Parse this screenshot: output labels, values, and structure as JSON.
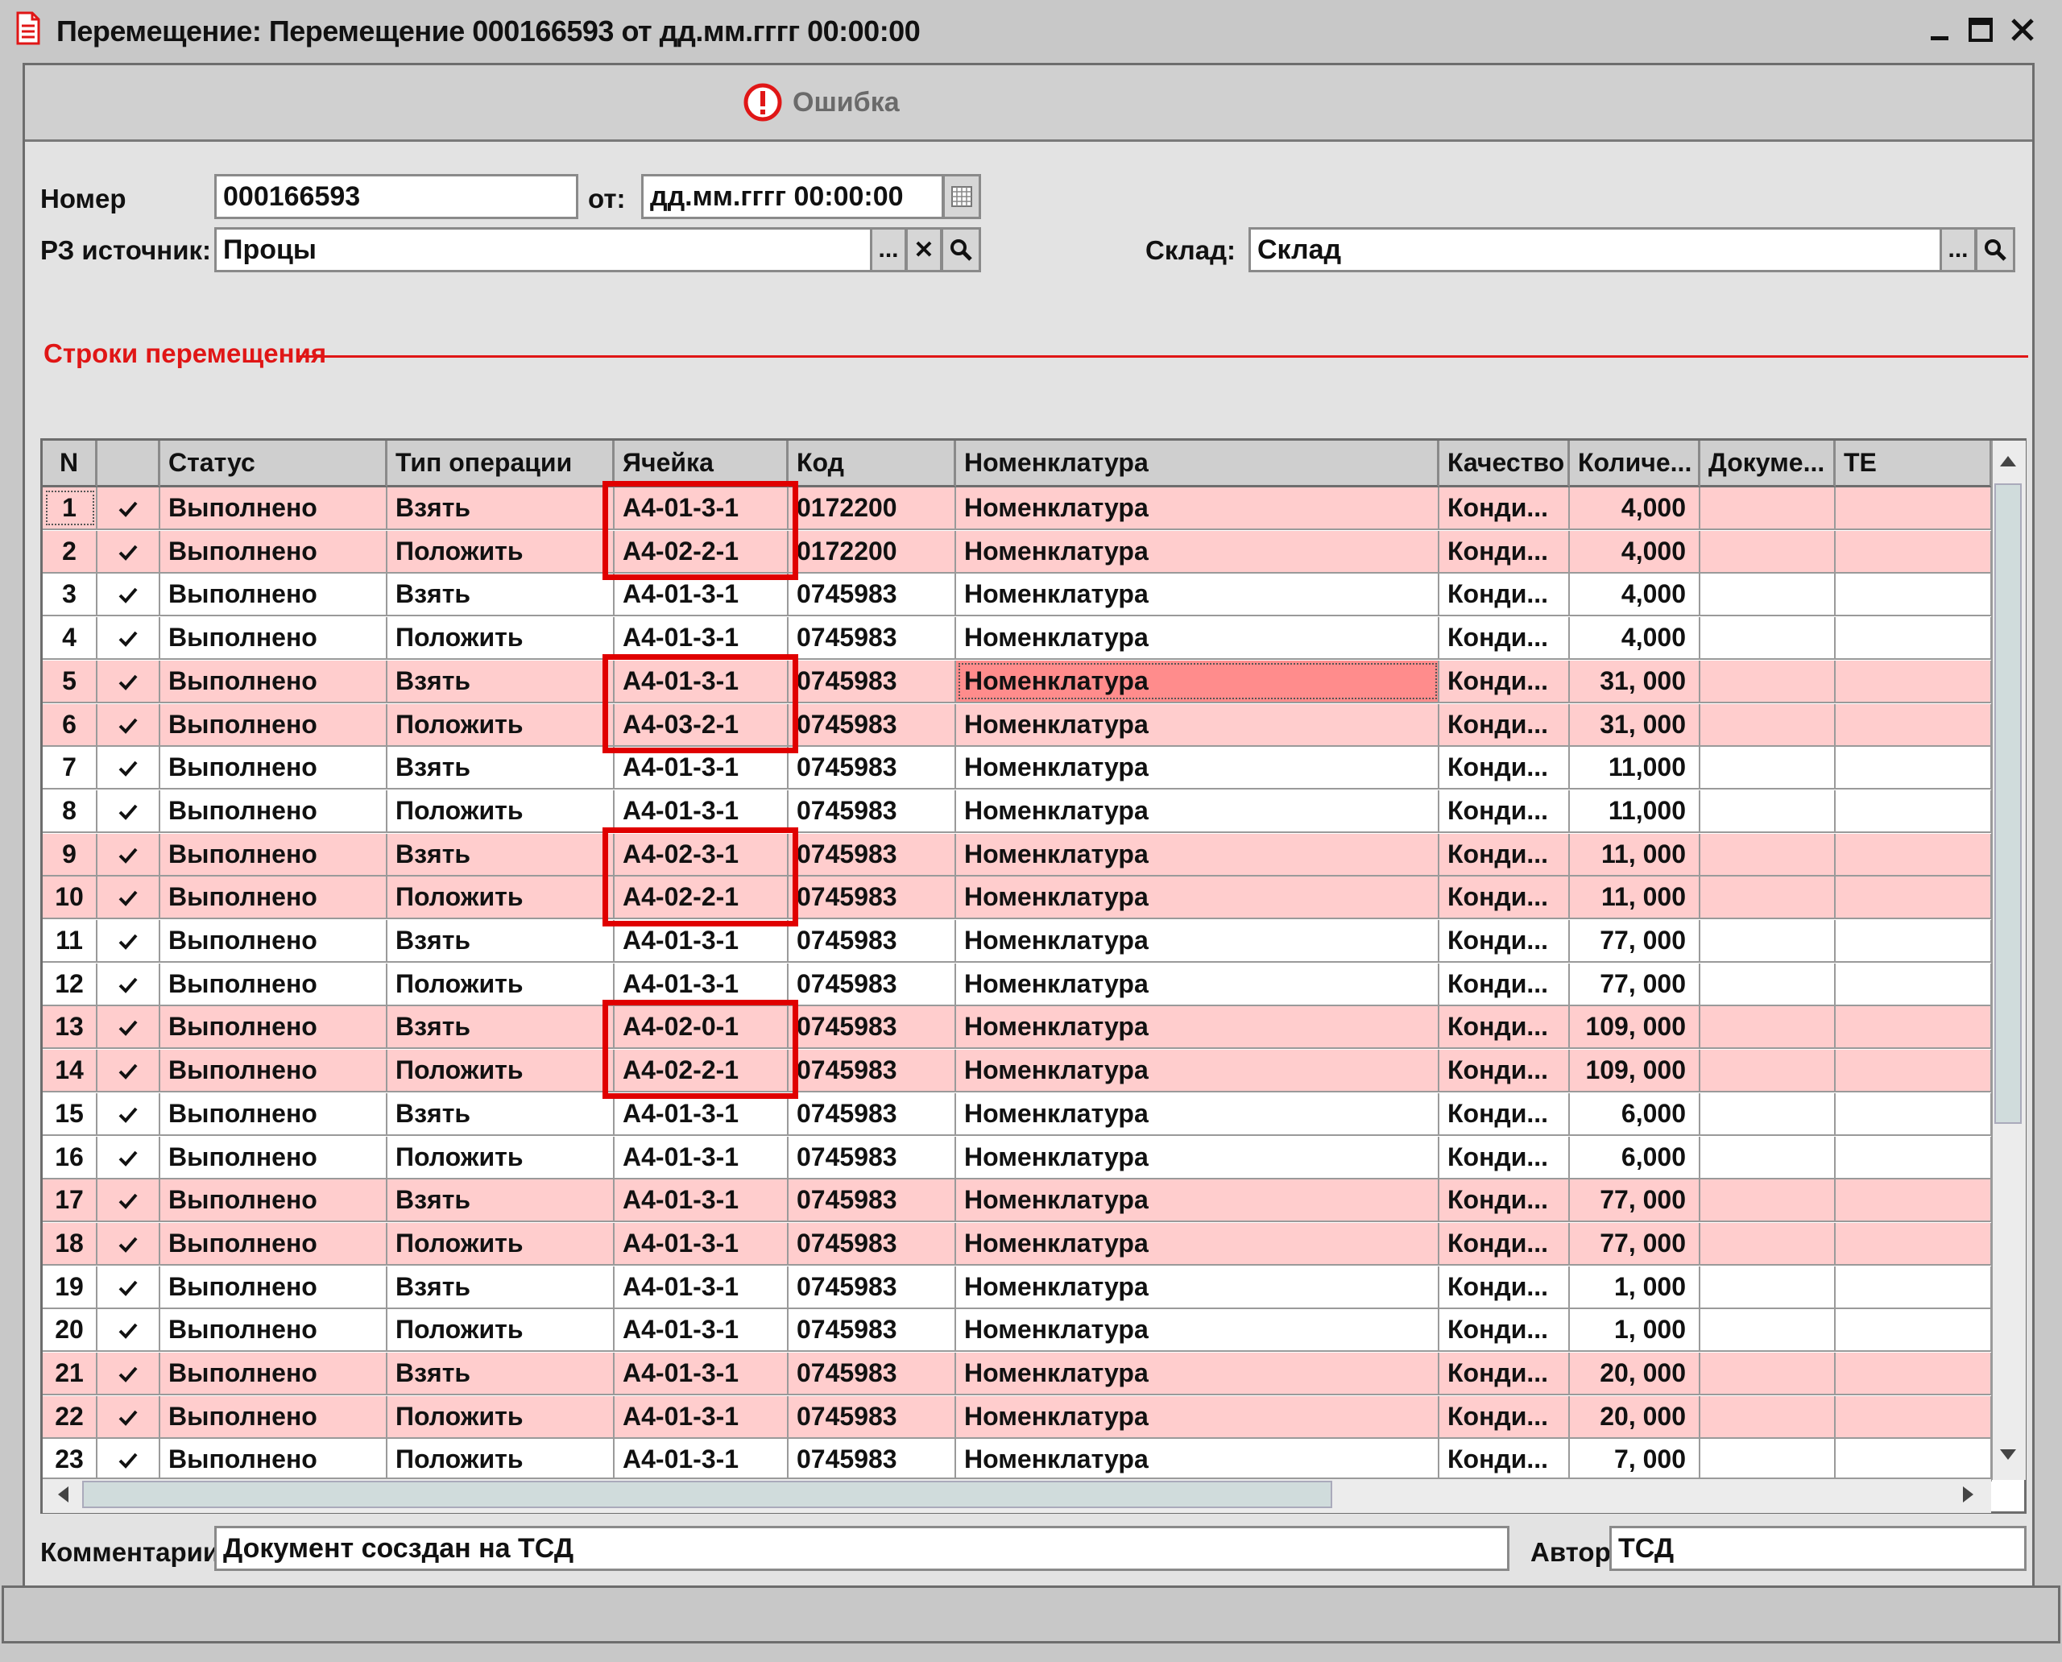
{
  "window": {
    "title": "Перемещение: Перемещение 000166593 от дд.мм.гггг 00:00:00",
    "icon": "document-icon"
  },
  "toolbar": {
    "error_label": "Ошибка",
    "error_icon": "error-icon"
  },
  "form": {
    "number_label": "Номер",
    "number_value": "000166593",
    "from_label": "от:",
    "date_value": "дд.мм.гггг 00:00:00",
    "source_label": "РЗ источник:",
    "source_value": "Процы",
    "warehouse_label": "Склад:",
    "warehouse_value": "Склад",
    "select_btn": "...",
    "clear_btn": "✕"
  },
  "section": {
    "title": "Строки перемещения"
  },
  "table": {
    "columns": [
      "N",
      "",
      "Статус",
      "Тип операции",
      "Ячейка",
      "Код",
      "Номенклатура",
      "Качество",
      "Количе...",
      "Докуме...",
      "ТЕ"
    ],
    "rows": [
      {
        "n": "1",
        "status": "Выполнено",
        "op": "Взять",
        "cell": "А4-01-3-1",
        "code": "0172200",
        "nom": "Номенклатура",
        "quality": "Конди...",
        "qty": "4,000",
        "hl": true
      },
      {
        "n": "2",
        "status": "Выполнено",
        "op": "Положить",
        "cell": "А4-02-2-1",
        "code": "0172200",
        "nom": "Номенклатура",
        "quality": "Конди...",
        "qty": "4,000",
        "hl": true
      },
      {
        "n": "3",
        "status": "Выполнено",
        "op": "Взять",
        "cell": "А4-01-3-1",
        "code": "0745983",
        "nom": "Номенклатура",
        "quality": "Конди...",
        "qty": "4,000",
        "hl": false
      },
      {
        "n": "4",
        "status": "Выполнено",
        "op": "Положить",
        "cell": "А4-01-3-1",
        "code": "0745983",
        "nom": "Номенклатура",
        "quality": "Конди...",
        "qty": "4,000",
        "hl": false
      },
      {
        "n": "5",
        "status": "Выполнено",
        "op": "Взять",
        "cell": "А4-01-3-1",
        "code": "0745983",
        "nom": "Номенклатура",
        "quality": "Конди...",
        "qty": "31, 000",
        "hl": true
      },
      {
        "n": "6",
        "status": "Выполнено",
        "op": "Положить",
        "cell": "А4-03-2-1",
        "code": "0745983",
        "nom": "Номенклатура",
        "quality": "Конди...",
        "qty": "31, 000",
        "hl": true
      },
      {
        "n": "7",
        "status": "Выполнено",
        "op": "Взять",
        "cell": "А4-01-3-1",
        "code": "0745983",
        "nom": "Номенклатура",
        "quality": "Конди...",
        "qty": "11,000",
        "hl": false
      },
      {
        "n": "8",
        "status": "Выполнено",
        "op": "Положить",
        "cell": "А4-01-3-1",
        "code": "0745983",
        "nom": "Номенклатура",
        "quality": "Конди...",
        "qty": "11,000",
        "hl": false
      },
      {
        "n": "9",
        "status": "Выполнено",
        "op": "Взять",
        "cell": "А4-02-3-1",
        "code": "0745983",
        "nom": "Номенклатура",
        "quality": "Конди...",
        "qty": "11, 000",
        "hl": true
      },
      {
        "n": "10",
        "status": "Выполнено",
        "op": "Положить",
        "cell": "А4-02-2-1",
        "code": "0745983",
        "nom": "Номенклатура",
        "quality": "Конди...",
        "qty": "11, 000",
        "hl": true
      },
      {
        "n": "11",
        "status": "Выполнено",
        "op": "Взять",
        "cell": "А4-01-3-1",
        "code": "0745983",
        "nom": "Номенклатура",
        "quality": "Конди...",
        "qty": "77, 000",
        "hl": false
      },
      {
        "n": "12",
        "status": "Выполнено",
        "op": "Положить",
        "cell": "А4-01-3-1",
        "code": "0745983",
        "nom": "Номенклатура",
        "quality": "Конди...",
        "qty": "77, 000",
        "hl": false
      },
      {
        "n": "13",
        "status": "Выполнено",
        "op": "Взять",
        "cell": "А4-02-0-1",
        "code": "0745983",
        "nom": "Номенклатура",
        "quality": "Конди...",
        "qty": "109, 000",
        "hl": true
      },
      {
        "n": "14",
        "status": "Выполнено",
        "op": "Положить",
        "cell": "А4-02-2-1",
        "code": "0745983",
        "nom": "Номенклатура",
        "quality": "Конди...",
        "qty": "109, 000",
        "hl": true
      },
      {
        "n": "15",
        "status": "Выполнено",
        "op": "Взять",
        "cell": "А4-01-3-1",
        "code": "0745983",
        "nom": "Номенклатура",
        "quality": "Конди...",
        "qty": "6,000",
        "hl": false
      },
      {
        "n": "16",
        "status": "Выполнено",
        "op": "Положить",
        "cell": "А4-01-3-1",
        "code": "0745983",
        "nom": "Номенклатура",
        "quality": "Конди...",
        "qty": "6,000",
        "hl": false
      },
      {
        "n": "17",
        "status": "Выполнено",
        "op": "Взять",
        "cell": "А4-01-3-1",
        "code": "0745983",
        "nom": "Номенклатура",
        "quality": "Конди...",
        "qty": "77, 000",
        "hl": true
      },
      {
        "n": "18",
        "status": "Выполнено",
        "op": "Положить",
        "cell": "А4-01-3-1",
        "code": "0745983",
        "nom": "Номенклатура",
        "quality": "Конди...",
        "qty": "77, 000",
        "hl": true
      },
      {
        "n": "19",
        "status": "Выполнено",
        "op": "Взять",
        "cell": "А4-01-3-1",
        "code": "0745983",
        "nom": "Номенклатура",
        "quality": "Конди...",
        "qty": "1, 000",
        "hl": false
      },
      {
        "n": "20",
        "status": "Выполнено",
        "op": "Положить",
        "cell": "А4-01-3-1",
        "code": "0745983",
        "nom": "Номенклатура",
        "quality": "Конди...",
        "qty": "1, 000",
        "hl": false
      },
      {
        "n": "21",
        "status": "Выполнено",
        "op": "Взять",
        "cell": "А4-01-3-1",
        "code": "0745983",
        "nom": "Номенклатура",
        "quality": "Конди...",
        "qty": "20, 000",
        "hl": true
      },
      {
        "n": "22",
        "status": "Выполнено",
        "op": "Положить",
        "cell": "А4-01-3-1",
        "code": "0745983",
        "nom": "Номенклатура",
        "quality": "Конди...",
        "qty": "20, 000",
        "hl": true
      },
      {
        "n": "23",
        "status": "Выполнено",
        "op": "Положить",
        "cell": "А4-01-3-1",
        "code": "0745983",
        "nom": "Номенклатура",
        "quality": "Конди...",
        "qty": "7, 000",
        "hl": false
      }
    ],
    "check_icon": "check-icon"
  },
  "footer": {
    "comment_label": "Комментарии:",
    "comment_value": "Документ сосздан на ТСД",
    "author_label": "Автор:",
    "author_value": "ТСД"
  },
  "colors": {
    "highlight_row": "#ffcdcd",
    "error_red": "#e01616",
    "selected_cell": "#ff8c8c"
  }
}
